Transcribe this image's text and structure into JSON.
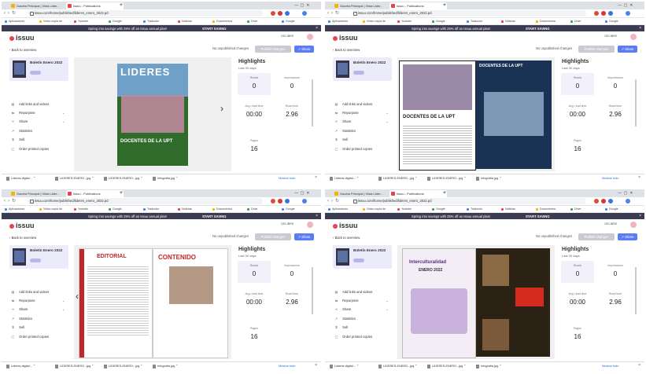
{
  "quadrants": [
    {
      "tabs": [
        "Gaceta Principal | Vista Lider...",
        "Issuu - Publications"
      ],
      "url": "issuu.com/home/published/lideres_enero_2022.pd",
      "bookmarks": [
        "Aplicaciones",
        "Vídeo copia de",
        "Youtube",
        "Google",
        "Traductor",
        "Noticias",
        "Documentos",
        "Drive",
        "Google"
      ],
      "banner_text": "Spring into savings with 25% off an Issuu annual plan!",
      "banner_cta": "START SAVING",
      "logo": "issuu",
      "username": "GELIBRE",
      "back": "Back to overview",
      "changes": "No unpublished changes",
      "publish": "Publish changes",
      "share": "Share",
      "doc_title": "Boletín Enero 2022",
      "menu": [
        {
          "icon": "▤",
          "label": "Add links and videos",
          "chev": ""
        },
        {
          "icon": "⇆",
          "label": "Repurpose",
          "chev": "⌄"
        },
        {
          "icon": "≺",
          "label": "Share",
          "chev": "⌄"
        },
        {
          "icon": "↗",
          "label": "Statistics",
          "chev": ""
        },
        {
          "icon": "$",
          "label": "Sell",
          "chev": ""
        },
        {
          "icon": "▢",
          "label": "Order printed copies",
          "chev": ""
        }
      ],
      "page_text": [
        "LIDERES",
        "DOCENTES DE LA UPT"
      ],
      "highlights_title": "Highlights",
      "highlights_sub": "Last 30 days",
      "stats": [
        {
          "label": "Reads",
          "value": "0"
        },
        {
          "label": "Impressions",
          "value": "0"
        },
        {
          "label": "Avg. read time",
          "value": "00:00"
        },
        {
          "label": "Read time",
          "value": "2.96"
        },
        {
          "label": "Pages",
          "value": "16"
        }
      ],
      "downloads": [
        "Lideres-digital...",
        "LIDERES-ENERO...jpg",
        "LIDERES-ENERO...jpg",
        "Infografía.jpg"
      ],
      "downloads_all": "Mostrar todo"
    },
    {
      "tabs": [
        "Gaceta Principal | Vista Lider...",
        "Issuu - Publications"
      ],
      "url": "issuu.com/home/published/lideres_enero_2022.pd",
      "bookmarks": [
        "Aplicaciones",
        "Vídeo copia de",
        "Youtube",
        "Google",
        "Traductor",
        "Noticias",
        "Documentos",
        "Drive",
        "Google"
      ],
      "banner_text": "Spring into savings with 25% off an Issuu annual plan!",
      "banner_cta": "START SAVING",
      "logo": "issuu",
      "username": "GELIBRE",
      "back": "Back to overview",
      "changes": "No unpublished changes",
      "publish": "Publish changes",
      "share": "Share",
      "doc_title": "Boletín Enero 2022",
      "menu": [
        {
          "icon": "▤",
          "label": "Add links and videos",
          "chev": ""
        },
        {
          "icon": "⇆",
          "label": "Repurpose",
          "chev": "⌄"
        },
        {
          "icon": "≺",
          "label": "Share",
          "chev": "⌄"
        },
        {
          "icon": "↗",
          "label": "Statistics",
          "chev": ""
        },
        {
          "icon": "$",
          "label": "Sell",
          "chev": ""
        },
        {
          "icon": "▢",
          "label": "Order printed copies",
          "chev": ""
        }
      ],
      "page_text": [
        "DOCENTES DE LA UPT",
        "DOCENTES DE LA UPT"
      ],
      "highlights_title": "Highlights",
      "highlights_sub": "Last 30 days",
      "stats": [
        {
          "label": "Reads",
          "value": "0"
        },
        {
          "label": "Impressions",
          "value": "0"
        },
        {
          "label": "Avg. read time",
          "value": "00:00"
        },
        {
          "label": "Read time",
          "value": "2.96"
        },
        {
          "label": "Pages",
          "value": "16"
        }
      ],
      "downloads": [
        "Lideres-digital...",
        "LIDERES-ENERO...jpg",
        "LIDERES-ENERO...jpg",
        "Infografía.jpg"
      ],
      "downloads_all": "Mostrar todo"
    },
    {
      "tabs": [
        "Gaceta Principal | Vista Lider...",
        "Issuu - Publications"
      ],
      "url": "issuu.com/home/published/lideres_enero_2022.pd",
      "bookmarks": [
        "Aplicaciones",
        "Vídeo copia de",
        "Youtube",
        "Google",
        "Traductor",
        "Noticias",
        "Documentos",
        "Drive",
        "Google"
      ],
      "banner_text": "Spring into savings with 25% off an Issuu annual plan!",
      "banner_cta": "START SAVING",
      "logo": "issuu",
      "username": "GELIBRE",
      "back": "Back to overview",
      "changes": "No unpublished changes",
      "publish": "Publish changes",
      "share": "Share",
      "doc_title": "Boletín Enero 2022",
      "menu": [
        {
          "icon": "▤",
          "label": "Add links and videos",
          "chev": ""
        },
        {
          "icon": "⇆",
          "label": "Repurpose",
          "chev": "⌄"
        },
        {
          "icon": "≺",
          "label": "Share",
          "chev": "⌄"
        },
        {
          "icon": "↗",
          "label": "Statistics",
          "chev": ""
        },
        {
          "icon": "$",
          "label": "Sell",
          "chev": ""
        },
        {
          "icon": "▢",
          "label": "Order printed copies",
          "chev": ""
        }
      ],
      "page_text": [
        "EDITORIAL",
        "CONTENIDO"
      ],
      "highlights_title": "Highlights",
      "highlights_sub": "Last 30 days",
      "stats": [
        {
          "label": "Reads",
          "value": "0"
        },
        {
          "label": "Impressions",
          "value": "0"
        },
        {
          "label": "Avg. read time",
          "value": "00:00"
        },
        {
          "label": "Read time",
          "value": "2.96"
        },
        {
          "label": "Pages",
          "value": "16"
        }
      ],
      "downloads": [
        "Lideres-digital...",
        "LIDERES-ENERO...jpg",
        "LIDERES-ENERO...jpg",
        "Infografía.jpg"
      ],
      "downloads_all": "Mostrar todo"
    },
    {
      "tabs": [
        "Gaceta Principal | Vista Lider...",
        "Issuu - Publications"
      ],
      "url": "issuu.com/home/published/lideres_enero_2022.pd",
      "bookmarks": [
        "Aplicaciones",
        "Vídeo copia de",
        "Youtube",
        "Google",
        "Traductor",
        "Noticias",
        "Documentos",
        "Drive",
        "Google"
      ],
      "banner_text": "Spring into savings with 25% off an Issuu annual plan!",
      "banner_cta": "START SAVING",
      "logo": "issuu",
      "username": "GELIBRE",
      "back": "Back to overview",
      "changes": "No unpublished changes",
      "publish": "Publish changes",
      "share": "Share",
      "doc_title": "Boletín Enero 2022",
      "menu": [
        {
          "icon": "▤",
          "label": "Add links and videos",
          "chev": ""
        },
        {
          "icon": "⇆",
          "label": "Repurpose",
          "chev": "⌄"
        },
        {
          "icon": "≺",
          "label": "Share",
          "chev": "⌄"
        },
        {
          "icon": "↗",
          "label": "Statistics",
          "chev": ""
        },
        {
          "icon": "$",
          "label": "Sell",
          "chev": ""
        },
        {
          "icon": "▢",
          "label": "Order printed copies",
          "chev": ""
        }
      ],
      "page_text": [
        "Interculturalidad",
        "ENERO 2022"
      ],
      "highlights_title": "Highlights",
      "highlights_sub": "Last 30 days",
      "stats": [
        {
          "label": "Reads",
          "value": "0"
        },
        {
          "label": "Impressions",
          "value": "0"
        },
        {
          "label": "Avg. read time",
          "value": "00:00"
        },
        {
          "label": "Read time",
          "value": "2.96"
        },
        {
          "label": "Pages",
          "value": "16"
        }
      ],
      "downloads": [
        "Lideres-digital...",
        "LIDERES-ENERO...jpg",
        "LIDERES-ENERO...jpg",
        "Infografía.jpg"
      ],
      "downloads_all": "Mostrar todo"
    }
  ],
  "colors": {
    "banner": "#3b3b52",
    "accent": "#5b7cf7",
    "logo_mark": "#e8424d",
    "card_bg": "#ecebf9",
    "pill": "#b9b6ea"
  }
}
